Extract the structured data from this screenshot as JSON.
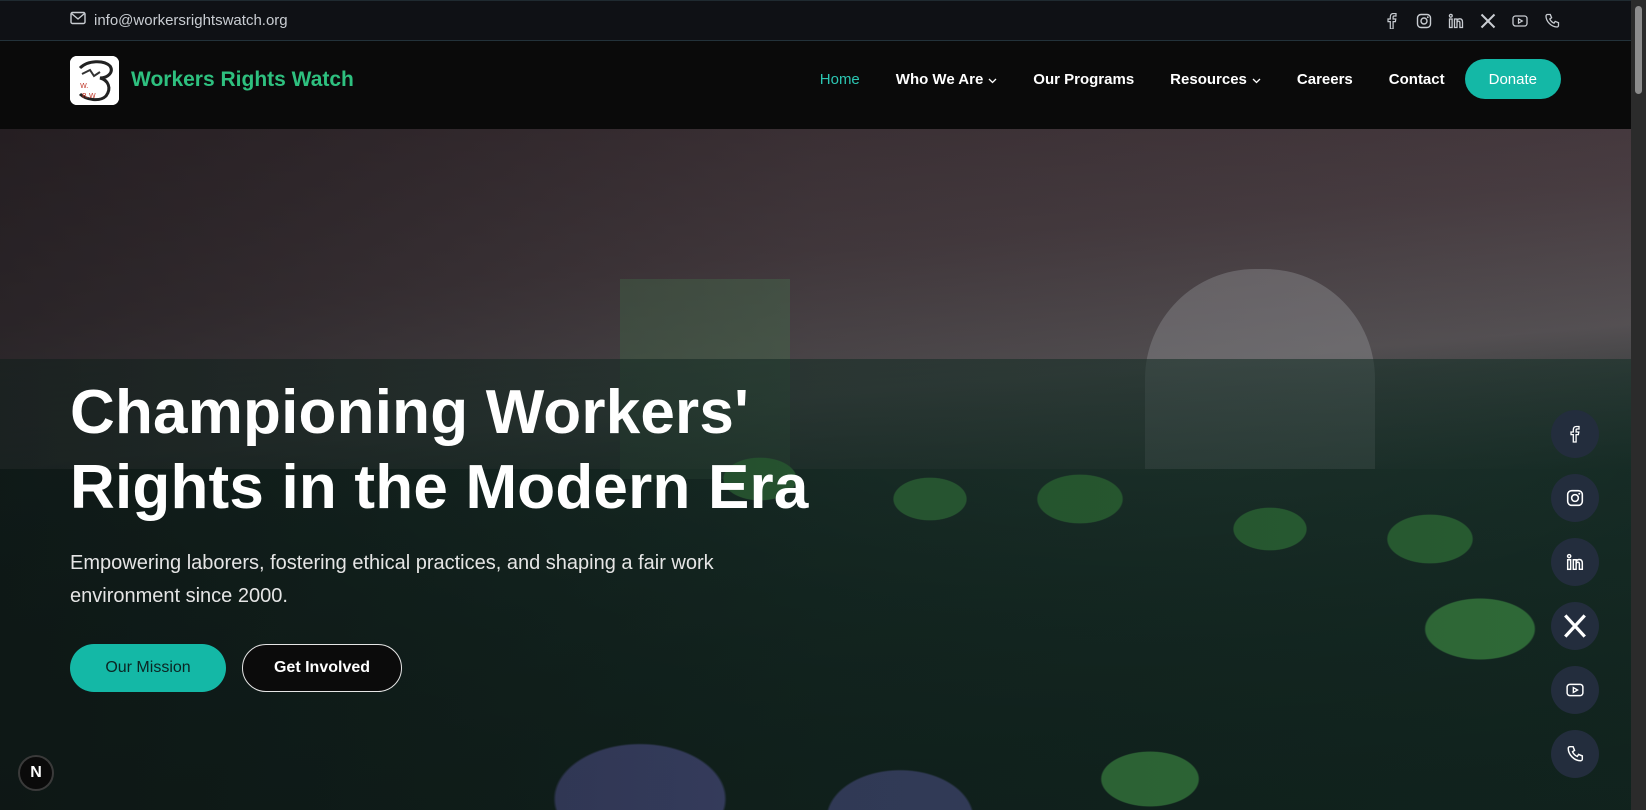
{
  "topbar": {
    "email": "info@workersrightswatch.org",
    "social_icons": [
      "facebook-icon",
      "instagram-icon",
      "linkedin-icon",
      "x-icon",
      "youtube-icon",
      "phone-icon"
    ]
  },
  "header": {
    "brand": "Workers Rights Watch",
    "nav": [
      {
        "label": "Home",
        "active": true
      },
      {
        "label": "Who We Are",
        "dropdown": true
      },
      {
        "label": "Our Programs"
      },
      {
        "label": "Resources",
        "dropdown": true
      },
      {
        "label": "Careers"
      },
      {
        "label": "Contact"
      }
    ],
    "donate_label": "Donate"
  },
  "hero": {
    "title_line1": "Championing Workers'",
    "title_line2": "Rights in the Modern Era",
    "subtitle": "Empowering laborers, fostering ethical practices, and shaping a fair work environment since 2000.",
    "primary_button": "Our Mission",
    "secondary_button": "Get Involved"
  },
  "floating_social": [
    "facebook-icon",
    "instagram-icon",
    "linkedin-icon",
    "x-icon",
    "youtube-icon",
    "phone-icon"
  ],
  "badge": "N",
  "colors": {
    "accent": "#14b8a6",
    "brand_green": "#2ec07f",
    "background": "#0a0a0a"
  }
}
